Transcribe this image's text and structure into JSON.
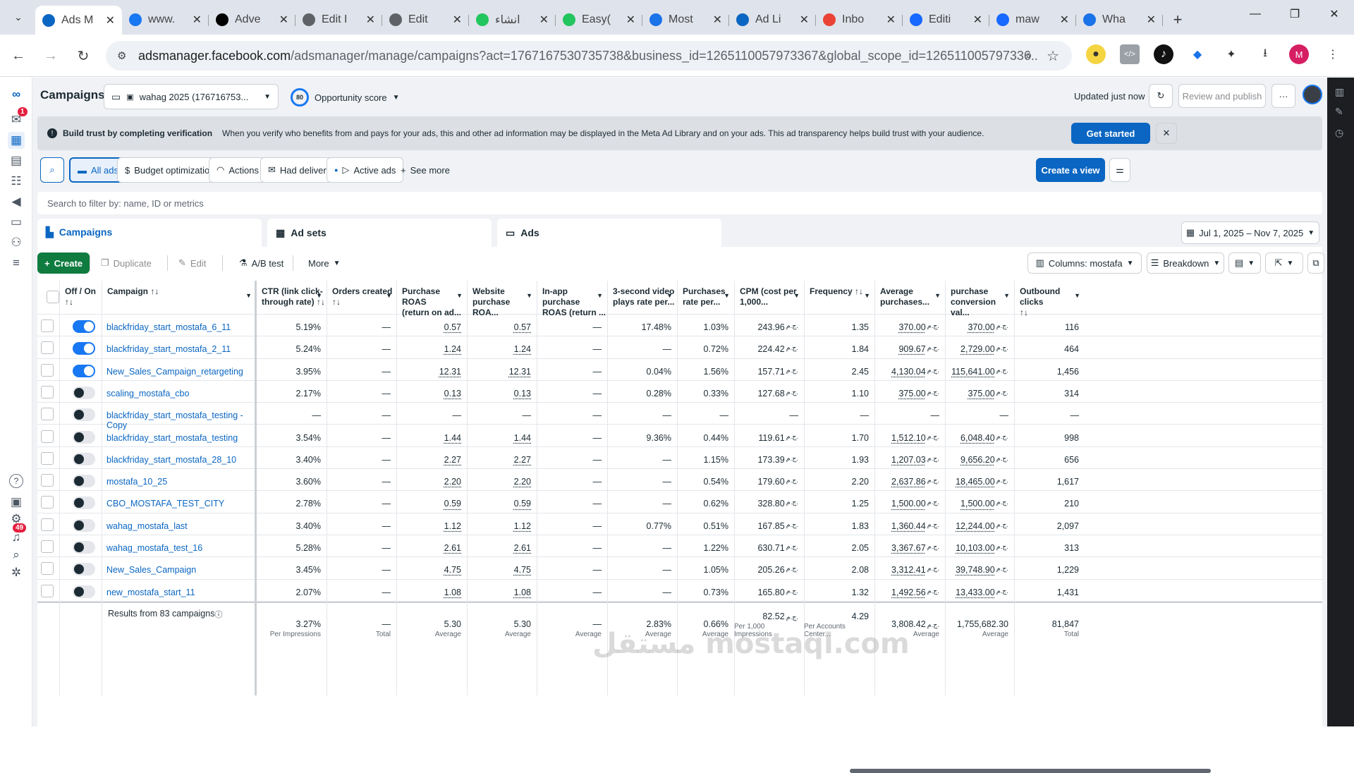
{
  "browser": {
    "tabs": [
      {
        "title": "Ads M",
        "color": "#0a66c2",
        "icon": "meta-icon",
        "active": true
      },
      {
        "title": "www.",
        "color": "#1877f2",
        "icon": "facebook-icon"
      },
      {
        "title": "Adve",
        "color": "#000000",
        "icon": "tiktok-icon"
      },
      {
        "title": "Edit I",
        "color": "#5f6368",
        "icon": "globe-icon"
      },
      {
        "title": "Edit",
        "color": "#5f6368",
        "icon": "globe-icon"
      },
      {
        "title": "انشاء",
        "color": "#22c55e",
        "icon": "flag-icon"
      },
      {
        "title": "Easy(",
        "color": "#22c55e",
        "icon": "flag-icon"
      },
      {
        "title": "Most",
        "color": "#1a73e8",
        "icon": "circle-icon"
      },
      {
        "title": "Ad Li",
        "color": "#0a66c2",
        "icon": "meta-icon"
      },
      {
        "title": "Inbo",
        "color": "#ea4335",
        "icon": "gmail-icon"
      },
      {
        "title": "Editi",
        "color": "#1769ff",
        "icon": "behance-icon"
      },
      {
        "title": "maw",
        "color": "#1769ff",
        "icon": "behance-icon"
      },
      {
        "title": "Wha",
        "color": "#1a73e8",
        "icon": "hand-icon"
      }
    ],
    "url_host": "adsmanager.facebook.com",
    "url_rest": "/adsmanager/manage/campaigns?act=1767167530735738&business_id=1265110057973367&global_scope_id=126511005797336...",
    "profile_initial": "M"
  },
  "nav": {
    "notif_badge": "1",
    "bell_badge": "49"
  },
  "header": {
    "title": "Campaigns",
    "account": "wahag 2025 (176716753...",
    "opportunity_score": "80",
    "opportunity_label": "Opportunity score",
    "updated": "Updated just now",
    "review_publish": "Review and publish",
    "more": "···"
  },
  "banner": {
    "title": "Build trust by completing verification",
    "text": "When you verify who benefits from and pays for your ads, this and other ad information may be displayed in the Meta Ad Library and on your ads. This ad transparency helps build trust with your audience.",
    "cta": "Get started"
  },
  "filters": {
    "all_ads": "All ads",
    "budget_optimization": "Budget optimization",
    "actions": "Actions",
    "had_delivery": "Had delivery",
    "active_ads": "Active ads",
    "see_more": "See more",
    "create_view": "Create a view",
    "search_placeholder": "Search to filter by: name, ID or metrics"
  },
  "levels": {
    "campaigns": "Campaigns",
    "ad_sets": "Ad sets",
    "ads": "Ads"
  },
  "date_range": "Jul 1, 2025 – Nov 7, 2025",
  "toolbar": {
    "create": "Create",
    "duplicate": "Duplicate",
    "edit": "Edit",
    "ab_test": "A/B test",
    "more": "More",
    "columns": "Columns: mostafa",
    "breakdown": "Breakdown"
  },
  "table": {
    "currency": "ج.م.",
    "headers": [
      {
        "l1": "Off / On",
        "l2": "↑↓"
      },
      {
        "l1": "Campaign ↑↓",
        "l2": ""
      },
      {
        "l1": "CTR (link click-",
        "l2": "through rate) ↑↓"
      },
      {
        "l1": "Orders created",
        "l2": "↑↓"
      },
      {
        "l1": "Purchase ROAS",
        "l2": "(return on ad..."
      },
      {
        "l1": "Website",
        "l2": "purchase ROA..."
      },
      {
        "l1": "In-app purchase",
        "l2": "ROAS (return ..."
      },
      {
        "l1": "3-second video",
        "l2": "plays rate per..."
      },
      {
        "l1": "Purchases",
        "l2": "rate per..."
      },
      {
        "l1": "CPM (cost per",
        "l2": "1,000..."
      },
      {
        "l1": "Frequency ↑↓",
        "l2": ""
      },
      {
        "l1": "Average",
        "l2": "purchases..."
      },
      {
        "l1": "purchase",
        "l2": "conversion val..."
      },
      {
        "l1": "Outbound clicks",
        "l2": "↑↓"
      }
    ],
    "rows": [
      {
        "on": true,
        "name": "blackfriday_start_mostafa_6_11",
        "ctr": "5.19%",
        "orders": "—",
        "proas": "0.57",
        "wroas": "0.57",
        "iroas": "—",
        "video": "17.48%",
        "prate": "1.03%",
        "cpm": "243.96",
        "freq": "1.35",
        "avg": "370.00",
        "conv": "370.00",
        "out": "116"
      },
      {
        "on": true,
        "name": "blackfriday_start_mostafa_2_11",
        "ctr": "5.24%",
        "orders": "—",
        "proas": "1.24",
        "wroas": "1.24",
        "iroas": "—",
        "video": "—",
        "prate": "0.72%",
        "cpm": "224.42",
        "freq": "1.84",
        "avg": "909.67",
        "conv": "2,729.00",
        "out": "464"
      },
      {
        "on": true,
        "name": "New_Sales_Campaign_retargeting",
        "ctr": "3.95%",
        "orders": "—",
        "proas": "12.31",
        "wroas": "12.31",
        "iroas": "—",
        "video": "0.04%",
        "prate": "1.56%",
        "cpm": "157.71",
        "freq": "2.45",
        "avg": "4,130.04",
        "conv": "115,641.00",
        "out": "1,456"
      },
      {
        "on": false,
        "name": "scaling_mostafa_cbo",
        "ctr": "2.17%",
        "orders": "—",
        "proas": "0.13",
        "wroas": "0.13",
        "iroas": "—",
        "video": "0.28%",
        "prate": "0.33%",
        "cpm": "127.68",
        "freq": "1.10",
        "avg": "375.00",
        "conv": "375.00",
        "out": "314"
      },
      {
        "on": false,
        "name": "blackfriday_start_mostafa_testing - Copy",
        "ctr": "—",
        "orders": "—",
        "proas": "—",
        "wroas": "—",
        "iroas": "—",
        "video": "—",
        "prate": "—",
        "cpm": "—",
        "freq": "—",
        "avg": "—",
        "conv": "—",
        "out": "—"
      },
      {
        "on": false,
        "name": "blackfriday_start_mostafa_testing",
        "ctr": "3.54%",
        "orders": "—",
        "proas": "1.44",
        "wroas": "1.44",
        "iroas": "—",
        "video": "9.36%",
        "prate": "0.44%",
        "cpm": "119.61",
        "freq": "1.70",
        "avg": "1,512.10",
        "conv": "6,048.40",
        "out": "998"
      },
      {
        "on": false,
        "name": "blackfriday_start_mostafa_28_10",
        "ctr": "3.40%",
        "orders": "—",
        "proas": "2.27",
        "wroas": "2.27",
        "iroas": "—",
        "video": "—",
        "prate": "1.15%",
        "cpm": "173.39",
        "freq": "1.93",
        "avg": "1,207.03",
        "conv": "9,656.20",
        "out": "656"
      },
      {
        "on": false,
        "name": "mostafa_10_25",
        "ctr": "3.60%",
        "orders": "—",
        "proas": "2.20",
        "wroas": "2.20",
        "iroas": "—",
        "video": "—",
        "prate": "0.54%",
        "cpm": "179.60",
        "freq": "2.20",
        "avg": "2,637.86",
        "conv": "18,465.00",
        "out": "1,617"
      },
      {
        "on": false,
        "name": "CBO_MOSTAFA_TEST_CITY",
        "ctr": "2.78%",
        "orders": "—",
        "proas": "0.59",
        "wroas": "0.59",
        "iroas": "—",
        "video": "—",
        "prate": "0.62%",
        "cpm": "328.80",
        "freq": "1.25",
        "avg": "1,500.00",
        "conv": "1,500.00",
        "out": "210"
      },
      {
        "on": false,
        "name": "wahag_mostafa_last",
        "ctr": "3.40%",
        "orders": "—",
        "proas": "1.12",
        "wroas": "1.12",
        "iroas": "—",
        "video": "0.77%",
        "prate": "0.51%",
        "cpm": "167.85",
        "freq": "1.83",
        "avg": "1,360.44",
        "conv": "12,244.00",
        "out": "2,097"
      },
      {
        "on": false,
        "name": "wahag_mostafa_test_16",
        "ctr": "5.28%",
        "orders": "—",
        "proas": "2.61",
        "wroas": "2.61",
        "iroas": "—",
        "video": "—",
        "prate": "1.22%",
        "cpm": "630.71",
        "freq": "2.05",
        "avg": "3,367.67",
        "conv": "10,103.00",
        "out": "313"
      },
      {
        "on": false,
        "name": "New_Sales_Campaign",
        "ctr": "3.45%",
        "orders": "—",
        "proas": "4.75",
        "wroas": "4.75",
        "iroas": "—",
        "video": "—",
        "prate": "1.05%",
        "cpm": "205.26",
        "freq": "2.08",
        "avg": "3,312.41",
        "conv": "39,748.90",
        "out": "1,229"
      },
      {
        "on": false,
        "name": "new_mostafa_start_11",
        "ctr": "2.07%",
        "orders": "—",
        "proas": "1.08",
        "wroas": "1.08",
        "iroas": "—",
        "video": "—",
        "prate": "0.73%",
        "cpm": "165.80",
        "freq": "1.32",
        "avg": "1,492.56",
        "conv": "13,433.00",
        "out": "1,431"
      }
    ],
    "totals": {
      "label": "Results from 83 campaigns",
      "ctr": "3.27%",
      "ctr_sub": "Per Impressions",
      "orders": "—",
      "orders_sub": "Total",
      "proas": "5.30",
      "proas_sub": "Average",
      "wroas": "5.30",
      "wroas_sub": "Average",
      "iroas": "—",
      "iroas_sub": "Average",
      "video": "2.83%",
      "video_sub": "Average",
      "prate": "0.66%",
      "prate_sub": "Average",
      "cpm": "82.52",
      "cpm_sub": "Per 1,000 Impressions",
      "freq": "4.29",
      "freq_sub": "Per Accounts Center...",
      "avg": "3,808.42",
      "avg_sub": "Average",
      "conv": "1,755,682.30",
      "conv_sub": "Average",
      "out": "81,847",
      "out_sub": "Total"
    }
  },
  "watermark": "مستقل mostaql.com"
}
